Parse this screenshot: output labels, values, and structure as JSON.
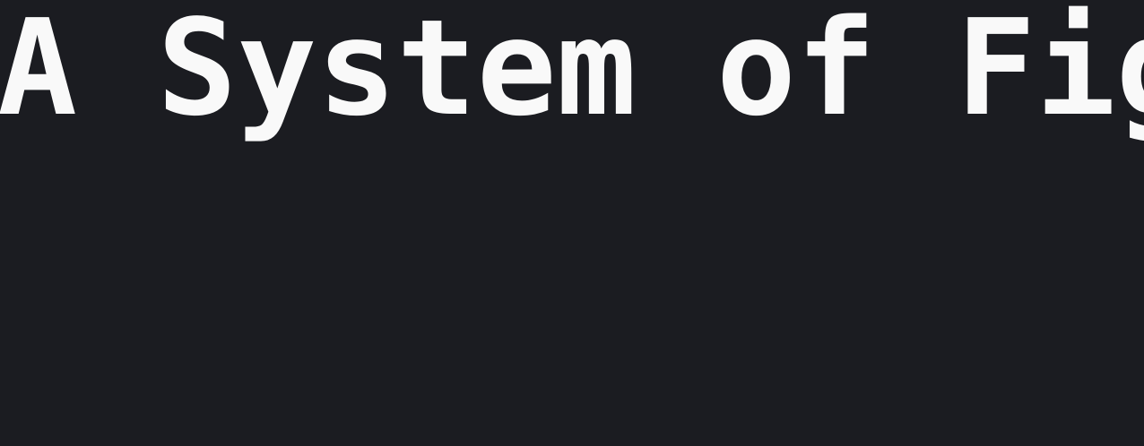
{
  "page": {
    "title": "A System of Figs"
  },
  "colors": {
    "background": "#1b1c21",
    "text": "#f9f9f9"
  }
}
